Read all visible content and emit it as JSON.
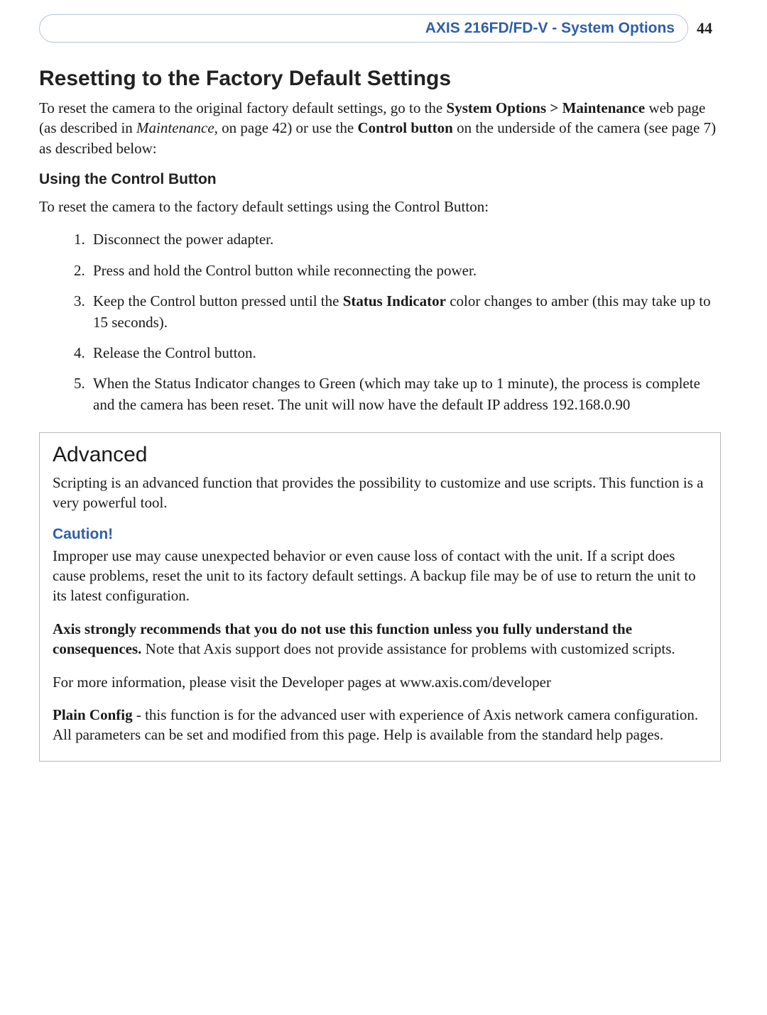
{
  "header": {
    "pill_text": "AXIS 216FD/FD-V - System Options",
    "page_number": "44"
  },
  "section": {
    "title": "Resetting to the Factory Default Settings",
    "intro_pre": "To reset the camera to the original factory default settings, go to the ",
    "intro_nav": "System Options > Maintenance",
    "intro_mid1": " web page (as described in ",
    "intro_ref_italic": "Maintenance,",
    "intro_mid2": " on page 42) or use the ",
    "intro_ctrl_bold": "Control button",
    "intro_post": " on the underside of the camera (see page 7) as described below:"
  },
  "subsection": {
    "heading": "Using the Control Button",
    "lead": "To reset the camera to the factory default settings using the Control Button:",
    "steps": {
      "s1": "Disconnect the power adapter.",
      "s2": "Press and hold the Control button while reconnecting the power.",
      "s3_pre": "Keep the Control button pressed until the ",
      "s3_bold": "Status Indicator",
      "s3_post": " color changes to amber (this may take up to 15 seconds).",
      "s4": "Release the Control button.",
      "s5": "When the Status Indicator changes to Green (which may take up to 1 minute), the process is complete and the camera has been reset. The unit will now have the default IP address 192.168.0.90"
    }
  },
  "advanced": {
    "heading": "Advanced",
    "p1": "Scripting is an advanced function that provides the possibility to customize and use scripts. This function is a very powerful tool.",
    "caution_label": "Caution!",
    "p2": "Improper use may cause unexpected behavior or even cause loss of contact with the unit. If a script does cause problems, reset the unit to its factory default settings. A backup file may be of use to return the unit to its latest configuration.",
    "p3_bold": "Axis strongly recommends that you do not use this function unless you fully understand the consequences.",
    "p3_post": " Note that Axis support does not provide assistance for problems with customized scripts.",
    "p4": "For more information, please visit the Developer pages at www.axis.com/developer",
    "p5_bold": "Plain Config",
    "p5_post": " - this function is for the advanced user with experience of Axis network camera configuration. All parameters can be set and modified from this page. Help is available from the standard help pages."
  }
}
